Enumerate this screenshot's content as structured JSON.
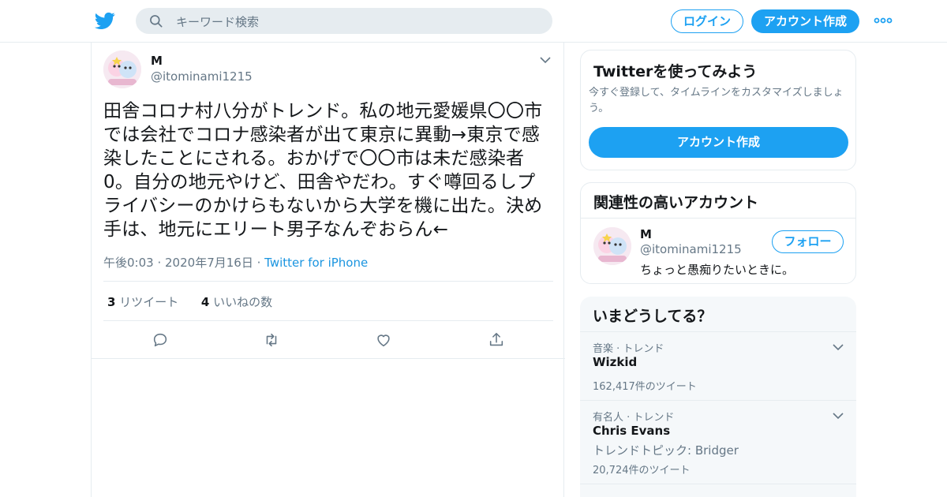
{
  "header": {
    "search_placeholder": "キーワード検索",
    "login_label": "ログイン",
    "signup_label": "アカウント作成"
  },
  "tweet": {
    "user_name": "M",
    "user_handle": "@itominami1215",
    "text": "田舎コロナ村八分がトレンド。私の地元愛媛県〇〇市では会社でコロナ感染者が出て東京に異動→東京で感染したことにされる。おかげで〇〇市は未だ感染者0。自分の地元やけど、田舎やだわ。すぐ噂回るしプライバシーのかけらもないから大学を機に出た。決め手は、地元にエリート男子なんぞおらん←",
    "time": "午後0:03",
    "date": "2020年7月16日",
    "source": "Twitter for iPhone",
    "retweet_count": "3",
    "retweet_label": "リツイート",
    "like_count": "4",
    "like_label": "いいねの数"
  },
  "join_card": {
    "title": "Twitterを使ってみよう",
    "description": "今すぐ登録して、タイムラインをカスタマイズしましょう。",
    "button_label": "アカウント作成"
  },
  "related": {
    "title": "関連性の高いアカウント",
    "user_name": "M",
    "user_handle": "@itominami1215",
    "bio": "ちょっと愚痴りたいときに。",
    "follow_label": "フォロー"
  },
  "trends": {
    "title": "いまどうしてる？",
    "items": [
      {
        "context": "音楽 · トレンド",
        "name": "Wizkid",
        "subtitle": "",
        "count": "162,417件のツイート"
      },
      {
        "context": "有名人 · トレンド",
        "name": "Chris Evans",
        "subtitle": "トレンドトピック: Bridger",
        "count": "20,724件のツイート"
      }
    ]
  },
  "colors": {
    "brand": "#1da1f2",
    "text_primary": "#14171a",
    "text_secondary": "#657786",
    "border": "#e6ecf0"
  }
}
